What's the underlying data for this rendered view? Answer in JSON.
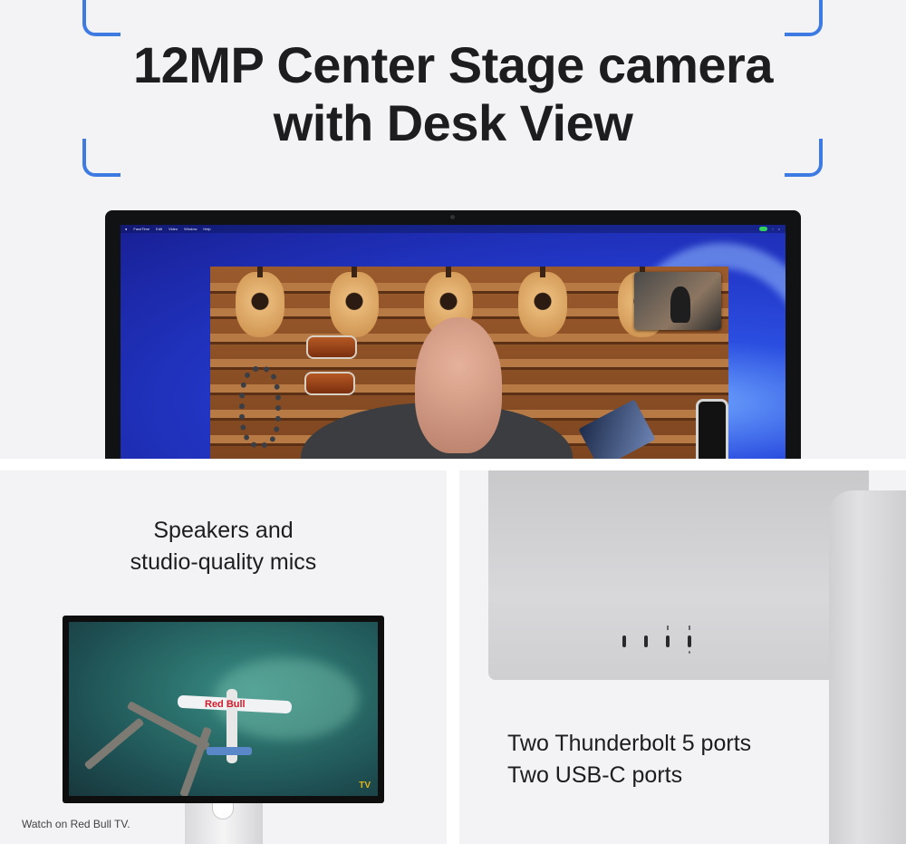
{
  "hero": {
    "title_line1": "12MP Center Stage camera",
    "title_line2": "with Desk View",
    "accent_color": "#3d7be3",
    "menubar_items": [
      "FaceTime",
      "Edit",
      "Video",
      "Window",
      "Help"
    ]
  },
  "speakers": {
    "title_line1": "Speakers and",
    "title_line2": "studio-quality mics",
    "screen_logo": "Red Bull",
    "screen_channel": "TV",
    "caption": "Watch on Red Bull TV."
  },
  "ports": {
    "line1": "Two Thunderbolt 5 ports",
    "line2": "Two USB-C ports"
  }
}
